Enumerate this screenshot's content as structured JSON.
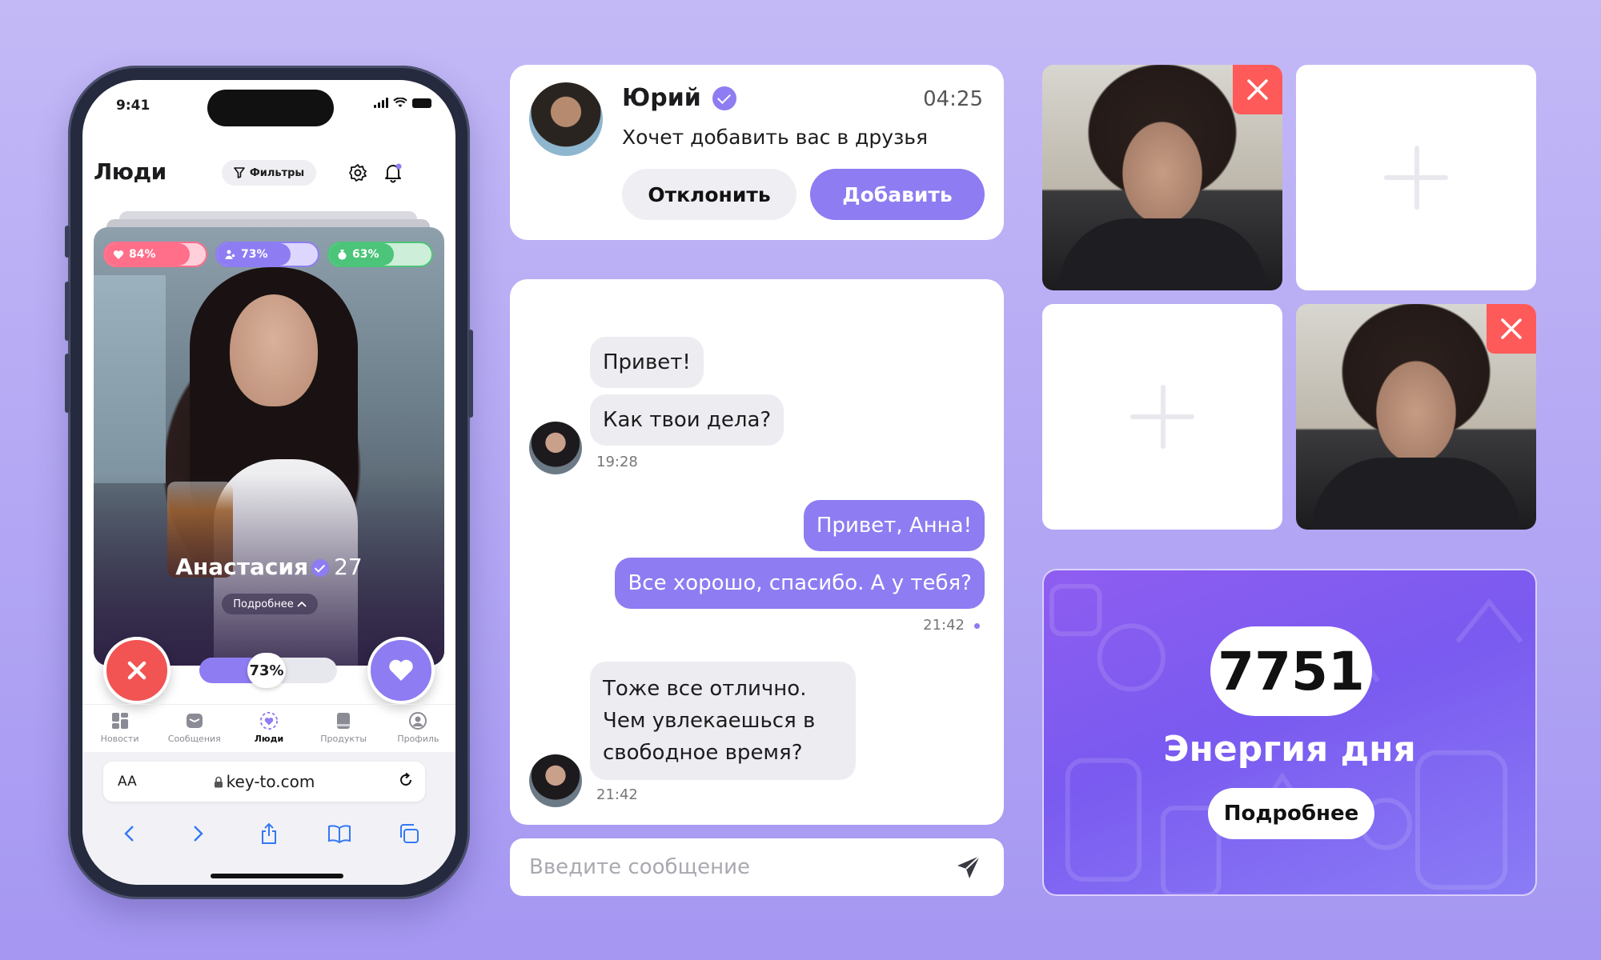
{
  "phone": {
    "status_time": "9:41",
    "header": {
      "title": "Люди",
      "filters_label": "Фильтры"
    },
    "meters": [
      {
        "icon": "heart-icon",
        "value": "84%",
        "fraction": 0.84,
        "color": "#ff6f8a",
        "track_color": "#ffd0da"
      },
      {
        "icon": "people-icon",
        "value": "73%",
        "fraction": 0.73,
        "color": "#8d7cf2",
        "track_color": "#ddd6ff"
      },
      {
        "icon": "money-bag-icon",
        "value": "63%",
        "fraction": 0.63,
        "color": "#4cc479",
        "track_color": "#cdeed9"
      }
    ],
    "profile": {
      "name": "Анастасия",
      "age": "27",
      "more_label": "Подробнее"
    },
    "match_percent": "73%",
    "tabs": [
      {
        "icon": "news-icon",
        "label": "Новости",
        "active": false
      },
      {
        "icon": "messages-icon",
        "label": "Сообщения",
        "active": false
      },
      {
        "icon": "people-heart-icon",
        "label": "Люди",
        "active": true
      },
      {
        "icon": "products-icon",
        "label": "Продукты",
        "active": false
      },
      {
        "icon": "profile-icon",
        "label": "Профиль",
        "active": false
      }
    ],
    "browser": {
      "aa_label": "AA",
      "url": "key-to.com"
    }
  },
  "friend_request": {
    "name": "Юрий",
    "time": "04:25",
    "text": "Хочет добавить вас в друзья",
    "decline_label": "Отклонить",
    "add_label": "Добавить"
  },
  "chat": {
    "messages": [
      {
        "dir": "in",
        "text": "Привет!"
      },
      {
        "dir": "in",
        "text": "Как твои дела?"
      },
      {
        "dir": "in_time",
        "text": "19:28"
      },
      {
        "dir": "out",
        "text": "Привет, Анна!"
      },
      {
        "dir": "out",
        "text": "Все хорошо, спасибо. А у тебя?"
      },
      {
        "dir": "out_time",
        "text": "21:42"
      },
      {
        "dir": "in",
        "text": "Тоже все отлично. Чем увлекаешься в свободное время?"
      },
      {
        "dir": "in_time",
        "text": "21:42"
      }
    ],
    "input_placeholder": "Введите сообщение"
  },
  "energy": {
    "value": "7751",
    "label": "Энергия дня",
    "button_label": "Подробнее"
  },
  "colors": {
    "accent": "#8d7cf2",
    "danger": "#ff5a5a",
    "background": "#b9aef5"
  }
}
